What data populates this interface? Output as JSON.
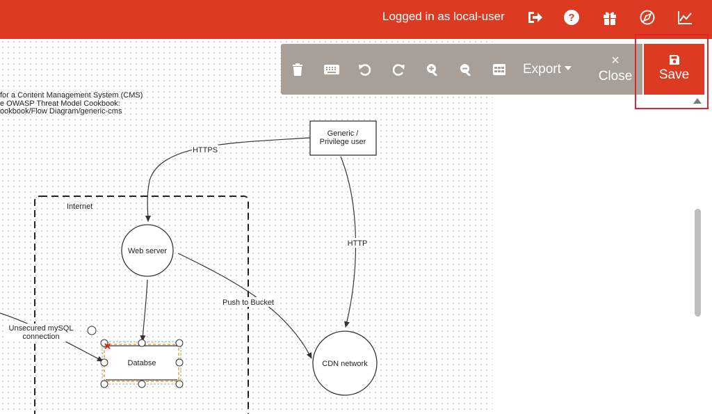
{
  "header": {
    "logged_in_text": "Logged in as local-user",
    "icons": [
      "logout-icon",
      "help-icon",
      "gift-icon",
      "compass-icon",
      "chart-line-icon"
    ]
  },
  "toolbar": {
    "icons": [
      "trash-icon",
      "keyboard-icon",
      "undo-icon",
      "redo-icon",
      "zoom-in-icon",
      "zoom-out-icon",
      "grid-icon"
    ],
    "export_label": "Export",
    "close_label": "Close",
    "close_symbol": "×",
    "save_label": "Save"
  },
  "diagram": {
    "description_lines": [
      "for a Content Management System (CMS)",
      "e OWASP Threat Model Cookbook:",
      "ookbook/Flow Diagram/generic-cms"
    ],
    "boundary_label": "Internet",
    "actor": {
      "line1": "Generic /",
      "line2": "Privilege user"
    },
    "web_server": "Web server",
    "cdn": "CDN network",
    "database": "Databse",
    "flows": {
      "https": "HTTPS",
      "http": "HTTP",
      "push": "Push to Bucket",
      "mysql_line1": "Unsecured mySQL",
      "mysql_line2": "connection"
    }
  },
  "colors": {
    "brand": "#dd3a22",
    "toolbar_bg": "#a79f98",
    "highlight": "#e0242f",
    "selection": "#f0a030"
  }
}
